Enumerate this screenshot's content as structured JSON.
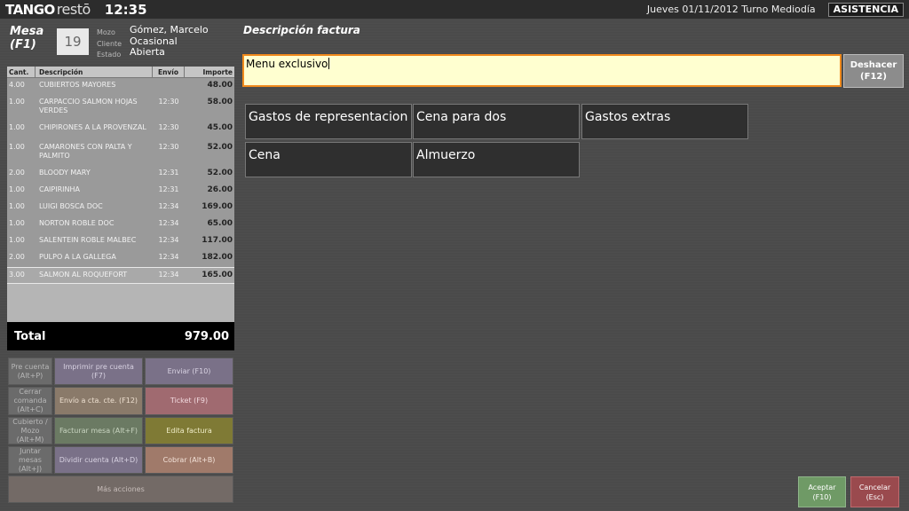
{
  "topbar": {
    "logo_tango": "TANGO",
    "logo_resto": "restō",
    "clock": "12:35",
    "date_shift": "Jueves 01/11/2012 Turno Mediodía",
    "asistencia": "ASISTENCIA"
  },
  "mesa": {
    "label_line1": "Mesa",
    "label_line2": "(F1)",
    "number": "19",
    "mozo_label": "Mozo",
    "cliente_label": "Cliente",
    "estado_label": "Estado",
    "mozo": "Gómez, Marcelo",
    "cliente": "Ocasional",
    "estado": "Abierta"
  },
  "items": {
    "headers": {
      "cant": "Cant.",
      "desc": "Descripción",
      "envio": "Envío",
      "importe": "Importe"
    },
    "rows": [
      {
        "cant": "4.00",
        "desc": "CUBIERTOS MAYORES",
        "envio": "",
        "importe": "48.00"
      },
      {
        "cant": "1.00",
        "desc": "CARPACCIO SALMON HOJAS VERDES",
        "envio": "12:30",
        "importe": "58.00"
      },
      {
        "cant": "1.00",
        "desc": "CHIPIRONES A LA PROVENZAL",
        "envio": "12:30",
        "importe": "45.00"
      },
      {
        "cant": "1.00",
        "desc": "CAMARONES CON PALTA Y PALMITO",
        "envio": "12:30",
        "importe": "52.00"
      },
      {
        "cant": "2.00",
        "desc": "BLOODY MARY",
        "envio": "12:31",
        "importe": "52.00"
      },
      {
        "cant": "1.00",
        "desc": "CAIPIRINHA",
        "envio": "12:31",
        "importe": "26.00"
      },
      {
        "cant": "1.00",
        "desc": "LUIGI BOSCA DOC",
        "envio": "12:34",
        "importe": "169.00"
      },
      {
        "cant": "1.00",
        "desc": "NORTON ROBLE DOC",
        "envio": "12:34",
        "importe": "65.00"
      },
      {
        "cant": "1.00",
        "desc": "SALENTEIN ROBLE MALBEC",
        "envio": "12:34",
        "importe": "117.00"
      },
      {
        "cant": "2.00",
        "desc": "PULPO A LA GALLEGA",
        "envio": "12:34",
        "importe": "182.00"
      },
      {
        "cant": "3.00",
        "desc": "SALMON AL ROQUEFORT",
        "envio": "12:34",
        "importe": "165.00"
      }
    ]
  },
  "total": {
    "label": "Total",
    "value": "979.00"
  },
  "actions": {
    "pre_cuenta": [
      "Pre cuenta",
      "(Alt+P)"
    ],
    "imprimir_pre_cuenta": "Imprimir pre cuenta (F7)",
    "enviar": "Enviar (F10)",
    "cerrar_comanda": [
      "Cerrar",
      "comanda",
      "(Alt+C)"
    ],
    "envio_cta_cte": "Envío a cta. cte. (F12)",
    "ticket": "Ticket (F9)",
    "cubierto_mozo": [
      "Cubierto /",
      "Mozo",
      "(Alt+M)"
    ],
    "facturar_mesa": "Facturar mesa (Alt+F)",
    "edita_factura": "Edita factura",
    "juntar_mesas": [
      "Juntar",
      "mesas",
      "(Alt+J)"
    ],
    "dividir_cuenta": "Dividir cuenta (Alt+D)",
    "cobrar": "Cobrar (Alt+B)",
    "mas_acciones": "Más acciones"
  },
  "description": {
    "title": "Descripción factura",
    "value": "Menu exclusivo",
    "undo_line1": "Deshacer",
    "undo_line2": "(F12)",
    "options": [
      "Gastos de representacion",
      "Cena para dos",
      "Gastos extras",
      "Cena",
      "Almuerzo"
    ]
  },
  "footer": {
    "accept_line1": "Aceptar",
    "accept_line2": "(F10)",
    "cancel_line1": "Cancelar",
    "cancel_line2": "(Esc)"
  },
  "colors": {
    "input_border": "#f08a1c",
    "input_bg": "#ffffd0",
    "accept": "#6f9a66",
    "cancel": "#9a4a4e"
  }
}
